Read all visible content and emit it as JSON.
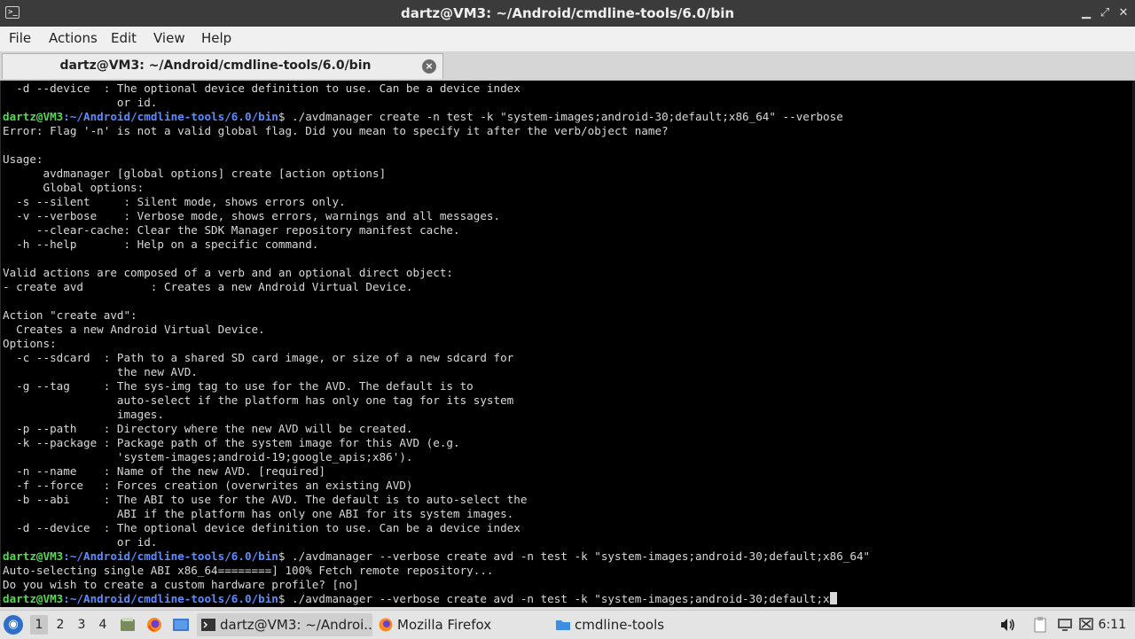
{
  "window": {
    "title": "dartz@VM3: ~/Android/cmdline-tools/6.0/bin",
    "app_icon": "terminal-icon",
    "controls": [
      "minimize-icon",
      "maximize-icon",
      "close-icon"
    ]
  },
  "menu": {
    "file": "File",
    "actions": "Actions",
    "edit": "Edit",
    "view": "View",
    "help": "Help"
  },
  "tab": {
    "label": "dartz@VM3: ~/Android/cmdline-tools/6.0/bin",
    "close": "×"
  },
  "terminal": {
    "lines": [
      {
        "text": "  -d --device  : The optional device definition to use. Can be a device index"
      },
      {
        "text": "                 or id."
      },
      {
        "user": "dartz@VM3",
        "path": ":~/Android/cmdline-tools/6.0/bin",
        "text": "$ ./avdmanager create -n test -k \"system-images;android-30;default;x86_64\" --verbose"
      },
      {
        "text": "Error: Flag '-n' is not a valid global flag. Did you mean to specify it after the verb/object name?"
      },
      {
        "text": ""
      },
      {
        "text": "Usage:"
      },
      {
        "text": "      avdmanager [global options] create [action options]"
      },
      {
        "text": "      Global options:"
      },
      {
        "text": "  -s --silent     : Silent mode, shows errors only."
      },
      {
        "text": "  -v --verbose    : Verbose mode, shows errors, warnings and all messages."
      },
      {
        "text": "     --clear-cache: Clear the SDK Manager repository manifest cache."
      },
      {
        "text": "  -h --help       : Help on a specific command."
      },
      {
        "text": ""
      },
      {
        "text": "Valid actions are composed of a verb and an optional direct object:"
      },
      {
        "text": "- create avd          : Creates a new Android Virtual Device."
      },
      {
        "text": ""
      },
      {
        "text": "Action \"create avd\":"
      },
      {
        "text": "  Creates a new Android Virtual Device."
      },
      {
        "text": "Options:"
      },
      {
        "text": "  -c --sdcard  : Path to a shared SD card image, or size of a new sdcard for"
      },
      {
        "text": "                 the new AVD."
      },
      {
        "text": "  -g --tag     : The sys-img tag to use for the AVD. The default is to"
      },
      {
        "text": "                 auto-select if the platform has only one tag for its system"
      },
      {
        "text": "                 images."
      },
      {
        "text": "  -p --path    : Directory where the new AVD will be created."
      },
      {
        "text": "  -k --package : Package path of the system image for this AVD (e.g."
      },
      {
        "text": "                 'system-images;android-19;google_apis;x86')."
      },
      {
        "text": "  -n --name    : Name of the new AVD. [required]"
      },
      {
        "text": "  -f --force   : Forces creation (overwrites an existing AVD)"
      },
      {
        "text": "  -b --abi     : The ABI to use for the AVD. The default is to auto-select the"
      },
      {
        "text": "                 ABI if the platform has only one ABI for its system images."
      },
      {
        "text": "  -d --device  : The optional device definition to use. Can be a device index"
      },
      {
        "text": "                 or id."
      },
      {
        "user": "dartz@VM3",
        "path": ":~/Android/cmdline-tools/6.0/bin",
        "text": "$ ./avdmanager --verbose create avd -n test -k \"system-images;android-30;default;x86_64\""
      },
      {
        "text": "Auto-selecting single ABI x86_64========] 100% Fetch remote repository..."
      },
      {
        "text": "Do you wish to create a custom hardware profile? [no]"
      },
      {
        "user": "dartz@VM3",
        "path": ":~/Android/cmdline-tools/6.0/bin",
        "text": "$ ./avdmanager --verbose create avd -n test -k \"system-images;android-30;default;x",
        "cursor": true
      }
    ],
    "colors": {
      "background": "#000000",
      "text": "#d9d9d9",
      "user": "#55d955",
      "path": "#5b8cff"
    }
  },
  "taskbar": {
    "start_icon": "start-menu-icon",
    "workspaces": [
      "1",
      "2",
      "3",
      "4"
    ],
    "active_workspace": "1",
    "launchers": [
      "file-manager-icon",
      "firefox-icon",
      "show-desktop-icon"
    ],
    "tasks": [
      {
        "label": "dartz@VM3: ~/Androi...",
        "icon": "terminal-icon",
        "active": true
      },
      {
        "label": "Mozilla Firefox",
        "icon": "firefox-icon",
        "active": false
      },
      {
        "label": "cmdline-tools",
        "icon": "folder-icon",
        "active": false
      }
    ],
    "tray": [
      "volume-icon",
      "clipboard-icon",
      "display-icon",
      "network-icon"
    ],
    "clock": "6:11"
  }
}
